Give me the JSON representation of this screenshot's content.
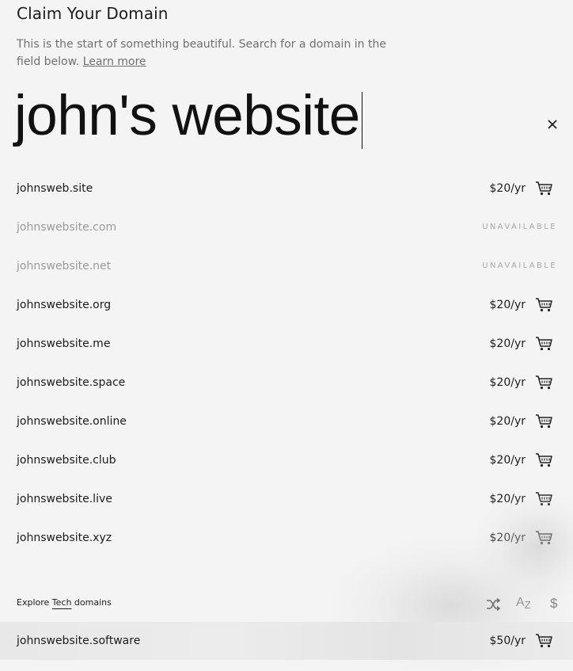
{
  "header": {
    "title": "Claim Your Domain",
    "subtitle": "This is the start of something beautiful. Search for a domain in the field below.",
    "learn_more": "Learn more"
  },
  "search": {
    "value": "john's website"
  },
  "results": [
    {
      "domain": "johnsweb.site",
      "price": "$20/yr",
      "available": true
    },
    {
      "domain": "johnswebsite.com",
      "status": "UNAVAILABLE",
      "available": false
    },
    {
      "domain": "johnswebsite.net",
      "status": "UNAVAILABLE",
      "available": false
    },
    {
      "domain": "johnswebsite.org",
      "price": "$20/yr",
      "available": true
    },
    {
      "domain": "johnswebsite.me",
      "price": "$20/yr",
      "available": true
    },
    {
      "domain": "johnswebsite.space",
      "price": "$20/yr",
      "available": true
    },
    {
      "domain": "johnswebsite.online",
      "price": "$20/yr",
      "available": true
    },
    {
      "domain": "johnswebsite.club",
      "price": "$20/yr",
      "available": true
    },
    {
      "domain": "johnswebsite.live",
      "price": "$20/yr",
      "available": true
    },
    {
      "domain": "johnswebsite.xyz",
      "price": "$20/yr",
      "available": true
    }
  ],
  "explore": {
    "prefix": "Explore",
    "category": "Tech",
    "suffix": "domains",
    "icons": [
      "shuffle-icon",
      "sort-alpha-icon",
      "sort-price-icon"
    ],
    "az_label": "A",
    "az_sub": "Z",
    "dollar_label": "$"
  },
  "tech_results": [
    {
      "domain": "johnswebsite.software",
      "price": "$50/yr",
      "available": true
    }
  ],
  "colors": {
    "background": "#f4f4f4",
    "text": "#1c1c1c",
    "muted": "#6f6f6f",
    "unavailable": "#9a9a9a"
  }
}
